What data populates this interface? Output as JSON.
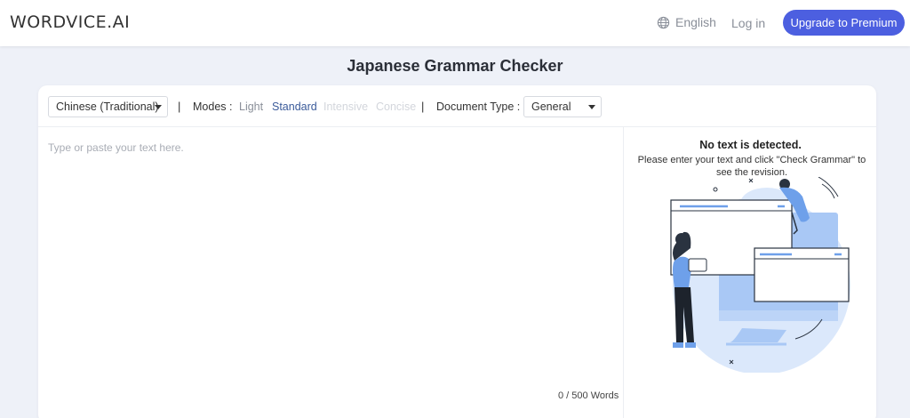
{
  "header": {
    "logo": "WORDVICE.AI",
    "language": "English",
    "login": "Log in",
    "upgrade": "Upgrade to Premium"
  },
  "page": {
    "title": "Japanese Grammar Checker"
  },
  "toolbar": {
    "language_select": "Chinese (Traditional)",
    "separator": "|",
    "modes_label": "Modes :",
    "modes": [
      {
        "label": "Light",
        "state": "normal"
      },
      {
        "label": "Standard",
        "state": "selected"
      },
      {
        "label": "Intensive",
        "state": "disabled"
      },
      {
        "label": "Concise",
        "state": "disabled"
      }
    ],
    "doc_type_label": "Document Type :",
    "doc_type_select": "General"
  },
  "editor": {
    "placeholder": "Type or paste your text here.",
    "word_count": "0 / 500 Words"
  },
  "result": {
    "title": "No text is detected.",
    "subtitle": "Please enter your text and click \"Check Grammar\" to see the revision."
  },
  "colors": {
    "accent": "#4c5fe0",
    "mode_selected": "#3b5b9a",
    "mode_normal": "#8a8f99",
    "mode_disabled": "#d3d6dc",
    "illustration_blue": "#a9c8f5"
  },
  "icons": {
    "language": "globe-icon",
    "select": "caret-down-icon"
  }
}
